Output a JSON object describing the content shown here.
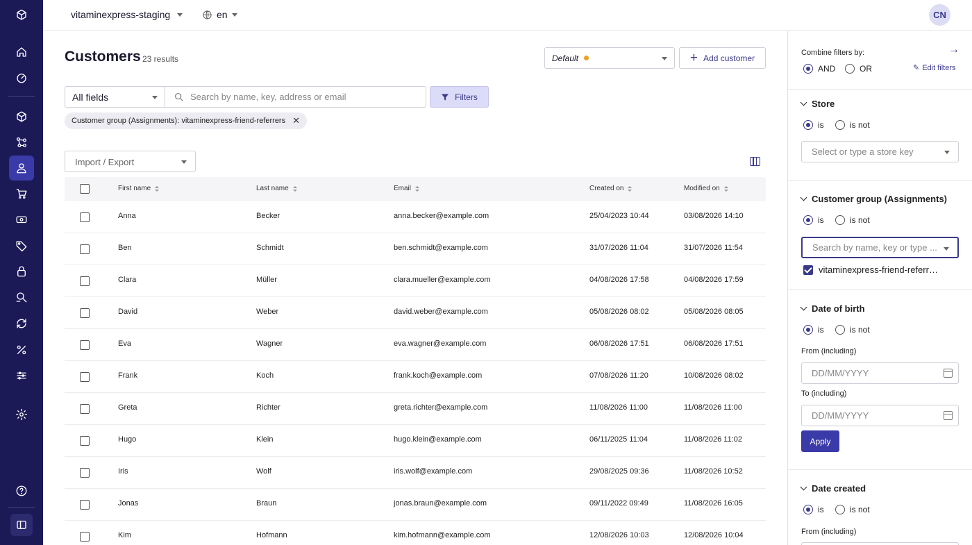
{
  "topbar": {
    "project": "vitaminexpress-staging",
    "language": "en",
    "avatar_initials": "CN"
  },
  "nav": {
    "icons": [
      "logo-icon",
      "home-icon",
      "dashboard-icon",
      "products-icon",
      "categories-icon",
      "customers-icon",
      "orders-icon",
      "prices-icon",
      "discounts-icon",
      "security-icon",
      "search-icon",
      "sync-icon",
      "percent-icon",
      "settings-sliders-icon",
      "gear-icon",
      "help-icon",
      "collapse-icon"
    ]
  },
  "main": {
    "title": "Customers",
    "results": "23 results",
    "view_select": "Default",
    "add_customer": "Add customer",
    "field_select": "All fields",
    "search_placeholder": "Search by name, key, address or email",
    "filters_button": "Filters",
    "active_filter_chip": "Customer group (Assignments): vitaminexpress-friend-referrers",
    "import_export": "Import / Export"
  },
  "table": {
    "columns": [
      "First name",
      "Last name",
      "Email",
      "Created on",
      "Modified on"
    ],
    "rows": [
      {
        "first": "Anna",
        "last": "Becker",
        "email": "anna.becker@example.com",
        "created": "25/04/2023 10:44",
        "modified": "03/08/2026 14:10"
      },
      {
        "first": "Ben",
        "last": "Schmidt",
        "email": "ben.schmidt@example.com",
        "created": "31/07/2026 11:04",
        "modified": "31/07/2026 11:54"
      },
      {
        "first": "Clara",
        "last": "Müller",
        "email": "clara.mueller@example.com",
        "created": "04/08/2026 17:58",
        "modified": "04/08/2026 17:59"
      },
      {
        "first": "David",
        "last": "Weber",
        "email": "david.weber@example.com",
        "created": "05/08/2026 08:02",
        "modified": "05/08/2026 08:05"
      },
      {
        "first": "Eva",
        "last": "Wagner",
        "email": "eva.wagner@example.com",
        "created": "06/08/2026 17:51",
        "modified": "06/08/2026 17:51"
      },
      {
        "first": "Frank",
        "last": "Koch",
        "email": "frank.koch@example.com",
        "created": "07/08/2026 11:20",
        "modified": "10/08/2026 08:02"
      },
      {
        "first": "Greta",
        "last": "Richter",
        "email": "greta.richter@example.com",
        "created": "11/08/2026 11:00",
        "modified": "11/08/2026 11:00"
      },
      {
        "first": "Hugo",
        "last": "Klein",
        "email": "hugo.klein@example.com",
        "created": "06/11/2025 11:04",
        "modified": "11/08/2026 11:02"
      },
      {
        "first": "Iris",
        "last": "Wolf",
        "email": "iris.wolf@example.com",
        "created": "29/08/2025 09:36",
        "modified": "11/08/2026 10:52"
      },
      {
        "first": "Jonas",
        "last": "Braun",
        "email": "jonas.braun@example.com",
        "created": "09/11/2022 09:49",
        "modified": "11/08/2026 16:05"
      },
      {
        "first": "Kim",
        "last": "Hofmann",
        "email": "kim.hofmann@example.com",
        "created": "12/08/2026 10:03",
        "modified": "12/08/2026 10:04"
      }
    ]
  },
  "panel": {
    "combine_label": "Combine filters by:",
    "and": "AND",
    "or": "OR",
    "edit_filters": "Edit filters",
    "is": "is",
    "is_not": "is not",
    "store": {
      "title": "Store",
      "placeholder": "Select or type a store key"
    },
    "customer_group": {
      "title": "Customer group (Assignments)",
      "placeholder": "Search by name, key or type ...",
      "selected": "vitaminexpress-friend-referrers"
    },
    "dob": {
      "title": "Date of birth",
      "from": "From (including)",
      "to": "To (including)",
      "date_placeholder": "DD/MM/YYYY",
      "apply": "Apply"
    },
    "date_created": {
      "title": "Date created",
      "from": "From (including)"
    }
  },
  "colors": {
    "nav_bg": "#1b1a57",
    "accent": "#3a3a8a",
    "nav_active": "#3a3aa8"
  }
}
